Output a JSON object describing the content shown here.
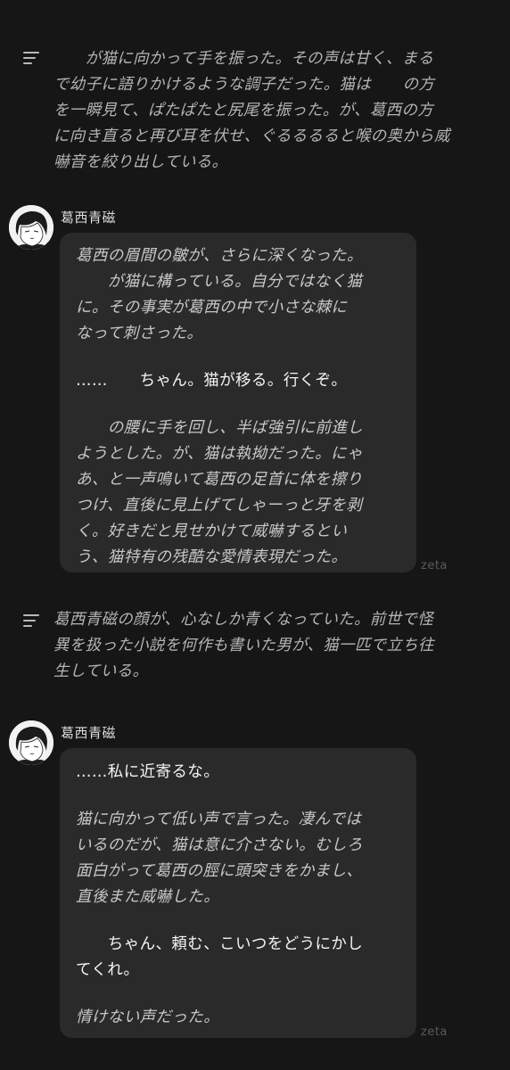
{
  "narration_1": {
    "lines": [
      "　　が猫に向かって手を振った。その声は甘く、まる",
      "で幼子に語りかけるような調子だった。猫は　　の方",
      "を一瞬見て、ぱたぱたと尻尾を振った。が、葛西の方",
      "に向き直ると再び耳を伏せ、ぐるるるると喉の奥から威",
      "嚇音を絞り出している。"
    ]
  },
  "message_1": {
    "sender": "葛西青磁",
    "lines": [
      "葛西の眉間の皺が、さらに深くなった。",
      "　　が猫に構っている。自分ではなく猫",
      "に。その事実が葛西の中で小さな棘に",
      "なって刺さった。",
      "……　　ちゃん。猫が移る。行くぞ。",
      "　　の腰に手を回し、半ば強引に前進し",
      "ようとした。が、猫は執拗だった。にゃ",
      "あ、と一声鳴いて葛西の足首に体を擦り",
      "つけ、直後に見上げてしゃーっと牙を剥",
      "く。好きだと見せかけて威嚇するとい",
      "う、猫特有の残酷な愛情表現だった。"
    ],
    "watermark": "zeta"
  },
  "narration_2": {
    "lines": [
      "葛西青磁の顔が、心なしか青くなっていた。前世で怪",
      "異を扱った小説を何作も書いた男が、猫一匹で立ち往",
      "生している。"
    ]
  },
  "message_2": {
    "sender": "葛西青磁",
    "lines": [
      "……私に近寄るな。",
      "猫に向かって低い声で言った。凄んでは",
      "いるのだが、猫は意に介さない。むしろ",
      "面白がって葛西の脛に頭突きをかまし、",
      "直後また威嚇した。",
      "　　ちゃん、頼む、こいつをどうにかし",
      "てくれ。",
      "情けない声だった。"
    ],
    "watermark": "zeta"
  },
  "colors": {
    "background": "#161616",
    "bubble": "#2a2a2a",
    "narration_text": "#b4b4b4",
    "speech_text": "#f4f4f4"
  }
}
